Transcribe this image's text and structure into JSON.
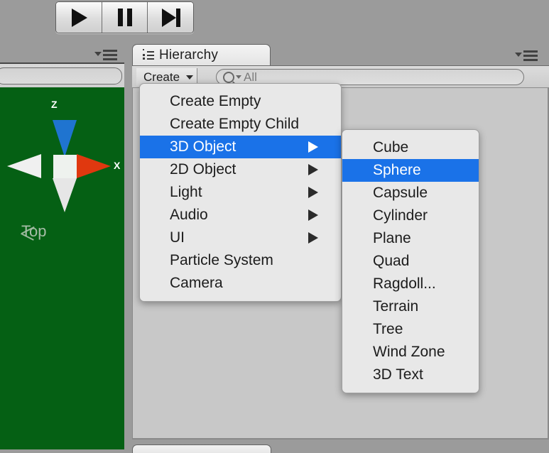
{
  "toolbar": {
    "buttons": [
      {
        "name": "play",
        "label": "Play"
      },
      {
        "name": "pause",
        "label": "Pause"
      },
      {
        "name": "step",
        "label": "Step"
      }
    ]
  },
  "scene_panel": {
    "gizmo": {
      "axis_z_label": "Z",
      "axis_x_label": "X",
      "view_label": "Top",
      "background_color": "#056014",
      "x_axis_color": "#e0380f",
      "z_axis_color": "#1f74d0",
      "neutral_axis_color": "#eeeeee"
    }
  },
  "hierarchy_panel": {
    "tab_label": "Hierarchy",
    "create_button": {
      "label": "Create"
    },
    "search": {
      "value": "All",
      "placeholder": "All"
    }
  },
  "create_menu": {
    "accent_color": "#1a72e8",
    "items": [
      {
        "label": "Create Empty",
        "has_submenu": false,
        "selected": false
      },
      {
        "label": "Create Empty Child",
        "has_submenu": false,
        "selected": false
      },
      {
        "label": "3D Object",
        "has_submenu": true,
        "selected": true
      },
      {
        "label": "2D Object",
        "has_submenu": true,
        "selected": false
      },
      {
        "label": "Light",
        "has_submenu": true,
        "selected": false
      },
      {
        "label": "Audio",
        "has_submenu": true,
        "selected": false
      },
      {
        "label": "UI",
        "has_submenu": true,
        "selected": false
      },
      {
        "label": "Particle System",
        "has_submenu": false,
        "selected": false
      },
      {
        "label": "Camera",
        "has_submenu": false,
        "selected": false
      }
    ]
  },
  "object_submenu": {
    "items": [
      {
        "label": "Cube",
        "selected": false
      },
      {
        "label": "Sphere",
        "selected": true
      },
      {
        "label": "Capsule",
        "selected": false
      },
      {
        "label": "Cylinder",
        "selected": false
      },
      {
        "label": "Plane",
        "selected": false
      },
      {
        "label": "Quad",
        "selected": false
      },
      {
        "label": "Ragdoll...",
        "selected": false
      },
      {
        "label": "Terrain",
        "selected": false
      },
      {
        "label": "Tree",
        "selected": false
      },
      {
        "label": "Wind Zone",
        "selected": false
      },
      {
        "label": "3D Text",
        "selected": false
      }
    ]
  }
}
